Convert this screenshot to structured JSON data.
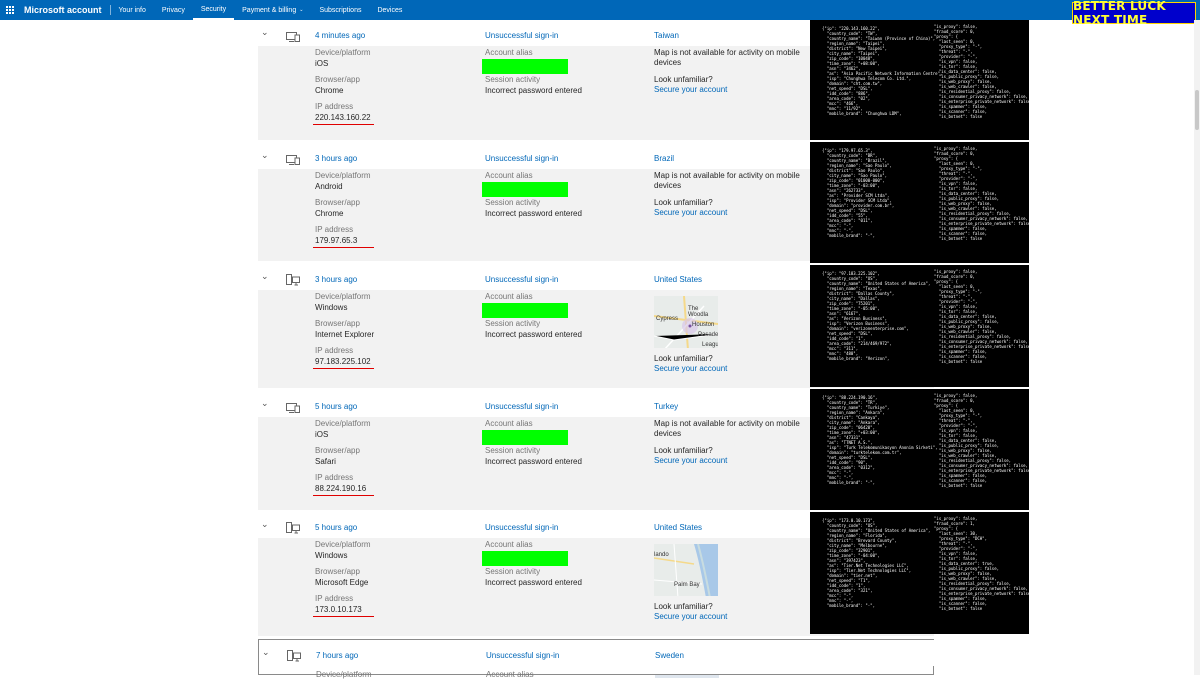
{
  "topbar": {
    "brand": "Microsoft account",
    "nav": [
      "Your info",
      "Privacy",
      "Security",
      "Payment & billing",
      "Subscriptions",
      "Devices"
    ],
    "active": "Security",
    "payment_caret": "⌄"
  },
  "badge": "BETTER LUCK NEXT TIME",
  "labels": {
    "device": "Device/platform",
    "browser": "Browser/app",
    "ip": "IP address",
    "alias": "Account alias",
    "session": "Session activity",
    "map_na": "Map is not available for activity on mobile devices",
    "unfamiliar": "Look unfamiliar?",
    "secure": "Secure your account"
  },
  "events": [
    {
      "time": "4 minutes ago",
      "status": "Unsuccessful sign-in",
      "country": "Taiwan",
      "device": "iOS",
      "browser": "Chrome",
      "ip": "220.143.160.22",
      "session": "Incorrect password entered",
      "device_type": "phone",
      "json_left": "{\"ip\": \"220.143.160.22\",\n  \"country_code\": \"TW\",\n  \"country_name\": \"Taiwan (Province of China)\",\n  \"region_name\": \"Taipei\",\n  \"district\": \"New Taipei\",\n  \"city_name\": \"Taipei\",\n  \"zip_code\": \"10048\",\n  \"time_zone\": \"+08:00\",\n  \"asn\": \"3462\",\n  \"as\": \"Asia Pacific Network Information Centre\",\n  \"isp\": \"Chunghwa Telecom Co. Ltd.\",\n  \"domain\": \"cht.com.tw\",\n  \"net_speed\": \"DSL\",\n  \"idd_code\": \"886\",\n  \"area_code\": \"02\",\n  \"mcc\": \"466\",\n  \"mnc\": \"11/92\",\n  \"mobile_brand\": \"Chunghwa LDM\",",
      "json_right": "\"is_proxy\": false,\n\"fraud_score\": 0,\n\"proxy\": {\n  \"last_seen\": 0,\n  \"proxy_type\": \"-\",\n  \"threat\": \"-\",\n  \"provider\": \"-\",\n  \"is_vpn\": false,\n  \"is_tor\": false,\n  \"is_data_center\": false,\n  \"is_public_proxy\": false,\n  \"is_web_proxy\": false,\n  \"is_web_crawler\": false,\n  \"is_residential_proxy\": false,\n  \"is_consumer_privacy_network\": false,\n  \"is_enterprise_private_network\": false,\n  \"is_spammer\": false,\n  \"is_scanner\": false,\n  \"is_botnet\": false"
    },
    {
      "time": "3 hours ago",
      "status": "Unsuccessful sign-in",
      "country": "Brazil",
      "device": "Android",
      "browser": "Chrome",
      "ip": "179.97.65.3",
      "session": "Incorrect password entered",
      "device_type": "phone",
      "json_left": "{\"ip\": \"179.97.65.3\",\n  \"country_code\": \"BR\",\n  \"country_name\": \"Brazil\",\n  \"region_name\": \"Sao Paulo\",\n  \"district\": \"Sao Paulo\",\n  \"city_name\": \"Sao Paulo\",\n  \"zip_code\": \"01000-000\",\n  \"time_zone\": \"-03:00\",\n  \"asn\": \"262733\",\n  \"as\": \"Provider SCM Ltda\",\n  \"isp\": \"Provider SCM Ltda\",\n  \"domain\": \"provider.com.br\",\n  \"net_speed\": \"DSL\",\n  \"idd_code\": \"55\",\n  \"area_code\": \"011\",\n  \"mcc\": \"-\",\n  \"mnc\": \"-\",\n  \"mobile_brand\": \"-\",",
      "json_right": "\"is_proxy\": false,\n\"fraud_score\": 0,\n\"proxy\": {\n  \"last_seen\": 0,\n  \"proxy_type\": \"-\",\n  \"threat\": \"-\",\n  \"provider\": \"-\",\n  \"is_vpn\": false,\n  \"is_tor\": false,\n  \"is_data_center\": false,\n  \"is_public_proxy\": false,\n  \"is_web_proxy\": false,\n  \"is_web_crawler\": false,\n  \"is_residential_proxy\": false,\n  \"is_consumer_privacy_network\": false,\n  \"is_enterprise_private_network\": false,\n  \"is_spammer\": false,\n  \"is_scanner\": false,\n  \"is_botnet\": false"
    },
    {
      "time": "3 hours ago",
      "status": "Unsuccessful sign-in",
      "country": "United States",
      "device": "Windows",
      "browser": "Internet Explorer",
      "ip": "97.183.225.102",
      "session": "Incorrect password entered",
      "device_type": "pc",
      "map_labels": [
        "The Woodla",
        "Cypress",
        "Houston",
        "Pasade",
        "Leagu"
      ],
      "json_left": "{\"ip\": \"97.183.225.102\",\n  \"country_code\": \"US\",\n  \"country_name\": \"United States of America\",\n  \"region_name\": \"Texas\",\n  \"district\": \"Dallas County\",\n  \"city_name\": \"Dallas\",\n  \"zip_code\": \"75201\",\n  \"time_zone\": \"-05:00\",\n  \"asn\": \"6167\",\n  \"as\": \"Verizon Business\",\n  \"isp\": \"Verizon Business\",\n  \"domain\": \"verizonenterprise.com\",\n  \"net_speed\": \"DSL\",\n  \"idd_code\": \"1\",\n  \"area_code\": \"214/469/972\",\n  \"mcc\": \"311\",\n  \"mnc\": \"480\",\n  \"mobile_brand\": \"Verizon\",",
      "json_right": "\"is_proxy\": false,\n\"fraud_score\": 0,\n\"proxy\": {\n  \"last_seen\": 0,\n  \"proxy_type\": \"-\",\n  \"threat\": \"-\",\n  \"provider\": \"-\",\n  \"is_vpn\": false,\n  \"is_tor\": false,\n  \"is_data_center\": false,\n  \"is_public_proxy\": false,\n  \"is_web_proxy\": false,\n  \"is_web_crawler\": false,\n  \"is_residential_proxy\": false,\n  \"is_consumer_privacy_network\": false,\n  \"is_enterprise_private_network\": false,\n  \"is_spammer\": false,\n  \"is_scanner\": false,\n  \"is_botnet\": false"
    },
    {
      "time": "5 hours ago",
      "status": "Unsuccessful sign-in",
      "country": "Turkey",
      "device": "iOS",
      "browser": "Safari",
      "ip": "88.224.190.16",
      "session": "Incorrect password entered",
      "device_type": "phone",
      "json_left": "{\"ip\": \"88.224.190.16\",\n  \"country_code\": \"TR\",\n  \"country_name\": \"Turkiye\",\n  \"region_name\": \"Ankara\",\n  \"district\": \"Cankaya\",\n  \"city_name\": \"Ankara\",\n  \"zip_code\": \"06420\",\n  \"time_zone\": \"+03:00\",\n  \"asn\": \"47331\",\n  \"as\": \"TTNET A.S.\",\n  \"isp\": \"Turk Telekomunikasyon Anonim Sirketi\",\n  \"domain\": \"turktelekom.com.tr\",\n  \"net_speed\": \"DSL\",\n  \"idd_code\": \"90\",\n  \"area_code\": \"0312\",\n  \"mcc\": \"-\",\n  \"mnc\": \"-\",\n  \"mobile_brand\": \"-\",",
      "json_right": "\"is_proxy\": false,\n\"fraud_score\": 0,\n\"proxy\": {\n  \"last_seen\": 0,\n  \"proxy_type\": \"-\",\n  \"threat\": \"-\",\n  \"provider\": \"-\",\n  \"is_vpn\": false,\n  \"is_tor\": false,\n  \"is_data_center\": false,\n  \"is_public_proxy\": false,\n  \"is_web_proxy\": false,\n  \"is_web_crawler\": false,\n  \"is_residential_proxy\": false,\n  \"is_consumer_privacy_network\": false,\n  \"is_enterprise_private_network\": false,\n  \"is_spammer\": false,\n  \"is_scanner\": false,\n  \"is_botnet\": false"
    },
    {
      "time": "5 hours ago",
      "status": "Unsuccessful sign-in",
      "country": "United States",
      "device": "Windows",
      "browser": "Microsoft Edge",
      "ip": "173.0.10.173",
      "session": "Incorrect password entered",
      "device_type": "pc",
      "map_labels": [
        "lando",
        "Palm Bay"
      ],
      "json_left": "{\"ip\": \"173.0.10.173\",\n  \"country_code\": \"US\",\n  \"country_name\": \"United States of America\",\n  \"region_name\": \"Florida\",\n  \"district\": \"Brevard County\",\n  \"city_name\": \"Melbourne\",\n  \"zip_code\": \"32901\",\n  \"time_zone\": \"-04:00\",\n  \"asn\": \"397423\",\n  \"as\": \"Tier.Net Technologies LLC\",\n  \"isp\": \"Tier.Net Technologies LLC\",\n  \"domain\": \"tier.net\",\n  \"net_speed\": \"T1\",\n  \"idd_code\": \"1\",\n  \"area_code\": \"321\",\n  \"mcc\": \"-\",\n  \"mnc\": \"-\",\n  \"mobile_brand\": \"-\",",
      "json_right": "\"is_proxy\": false,\n\"fraud_score\": 1,\n\"proxy\": {\n  \"last_seen\": 30,\n  \"proxy_type\": \"DCH\",\n  \"threat\": \"-\",\n  \"provider\": \"-\",\n  \"is_vpn\": false,\n  \"is_tor\": false,\n  \"is_data_center\": true,\n  \"is_public_proxy\": false,\n  \"is_web_proxy\": false,\n  \"is_web_crawler\": false,\n  \"is_residential_proxy\": false,\n  \"is_consumer_privacy_network\": false,\n  \"is_enterprise_private_network\": false,\n  \"is_spammer\": false,\n  \"is_scanner\": false,\n  \"is_botnet\": false"
    },
    {
      "time": "7 hours ago",
      "status": "Unsuccessful sign-in",
      "country": "Sweden",
      "device_type": "pc"
    }
  ]
}
